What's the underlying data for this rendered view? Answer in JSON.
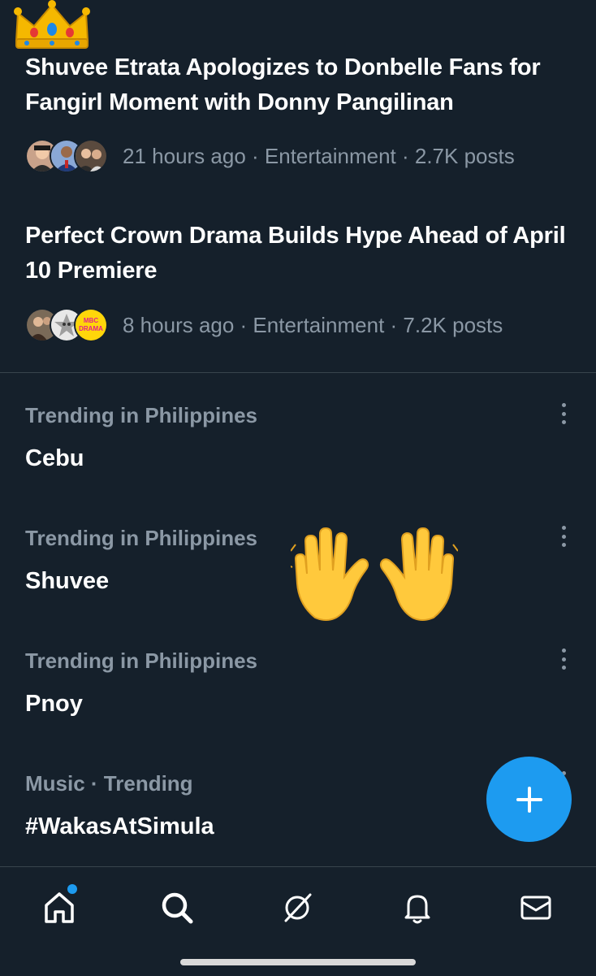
{
  "news": [
    {
      "title": "Shuvee Etrata Apologizes to Donbelle Fans for Fangirl Moment with Donny Pangilinan",
      "meta": "21 hours ago · Entertainment · 2.7K posts"
    },
    {
      "title": "Perfect Crown Drama Builds Hype Ahead of April 10 Premiere",
      "meta": "8 hours ago · Entertainment · 7.2K posts",
      "logo_text": [
        "MBC",
        "DRAMA"
      ]
    }
  ],
  "trends": [
    {
      "context": "Trending in Philippines",
      "name": "Cebu"
    },
    {
      "context": "Trending in Philippines",
      "name": "Shuvee"
    },
    {
      "context": "Trending in Philippines",
      "name": "Pnoy"
    },
    {
      "context": "Music · Trending",
      "name": "#WakasAtSimula"
    }
  ],
  "stickers": [
    "crown-emoji",
    "raising-hands-emoji"
  ],
  "fab": {
    "icon": "plus-icon"
  },
  "bottom_nav": [
    "home-icon",
    "search-icon",
    "grok-icon",
    "notifications-icon",
    "messages-icon"
  ],
  "colors": {
    "background": "#15202b",
    "text": "#ffffff",
    "secondary_text": "#8b98a5",
    "accent": "#1d9bf0",
    "divider": "#38444d"
  }
}
